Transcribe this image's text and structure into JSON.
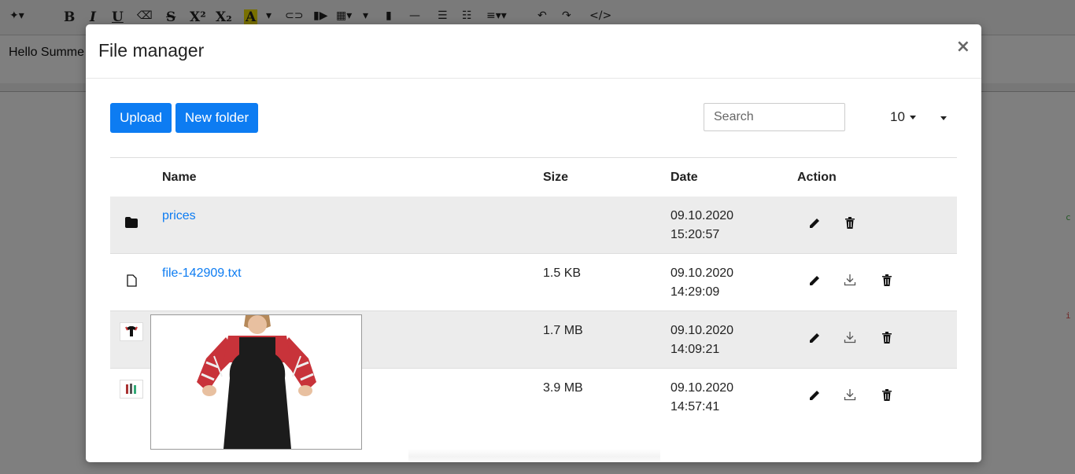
{
  "editor": {
    "text": "Hello Summe",
    "tools": [
      "B",
      "I",
      "U",
      "S",
      "X²",
      "X₂",
      "A",
      "</>"
    ]
  },
  "modal": {
    "title": "File manager",
    "close": "×"
  },
  "toolbar": {
    "upload_label": "Upload",
    "new_folder_label": "New folder",
    "search_placeholder": "Search",
    "per_page": "10"
  },
  "table": {
    "headers": [
      "Name",
      "Size",
      "Date",
      "Action"
    ],
    "rows": [
      {
        "type": "folder-icon",
        "name": "prices",
        "size": "",
        "date": "09.10.2020",
        "time": "15:20:57"
      },
      {
        "type": "file-icon",
        "name": "file-142909.txt",
        "size": "1.5 KB",
        "date": "09.10.2020",
        "time": "14:29:09"
      },
      {
        "type": "image-thumb",
        "name": "",
        "size": "1.7 MB",
        "date": "09.10.2020",
        "time": "14:09:21"
      },
      {
        "type": "image-thumb",
        "name": "",
        "size": "3.9 MB",
        "date": "09.10.2020",
        "time": "14:57:41"
      }
    ]
  },
  "colors": {
    "primary": "#0d7cf2",
    "overlay": "rgba(0,0,0,0.5)"
  }
}
